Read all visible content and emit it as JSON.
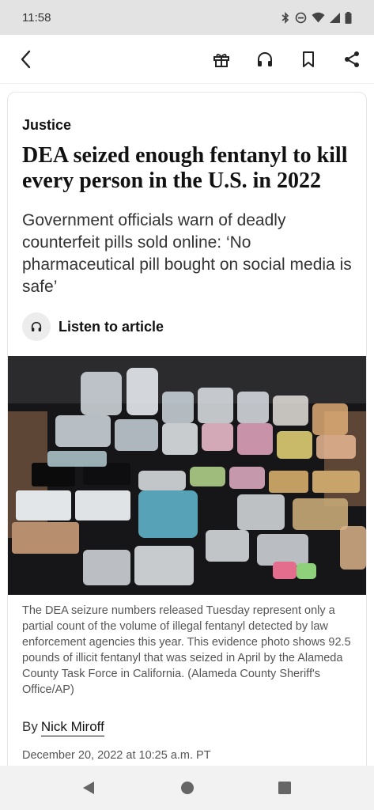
{
  "status_bar": {
    "time": "11:58",
    "icons": [
      "bluetooth-icon",
      "do-not-disturb-icon",
      "wifi-icon",
      "signal-icon",
      "battery-icon"
    ]
  },
  "toolbar": {
    "back_icon": "chevron-left-icon",
    "actions": [
      "gift-icon",
      "headphones-icon",
      "bookmark-icon",
      "share-icon"
    ]
  },
  "article": {
    "kicker": "Justice",
    "headline": "DEA seized enough fentanyl to kill every person in the U.S. in 2022",
    "subhead": "Government officials warn of deadly counterfeit pills sold online: ‘No pharmaceutical pill bought on social media is safe’",
    "listen_label": "Listen to article",
    "photo_caption": "The DEA seizure numbers released Tuesday represent only a partial count of the volume of illegal fentanyl detected by law enforcement agencies this year. This evidence photo shows 92.5 pounds of illicit fentanyl that was seized in April by the Alameda County Task Force in California. (Alameda County Sheriff's Office/AP)",
    "byline_prefix": "By",
    "author": "Nick Miroff",
    "date": "December 20, 2022 at 10:25 a.m. PT"
  },
  "nav_bar": {
    "buttons": [
      "back-triangle-icon",
      "home-circle-icon",
      "recents-square-icon"
    ]
  }
}
